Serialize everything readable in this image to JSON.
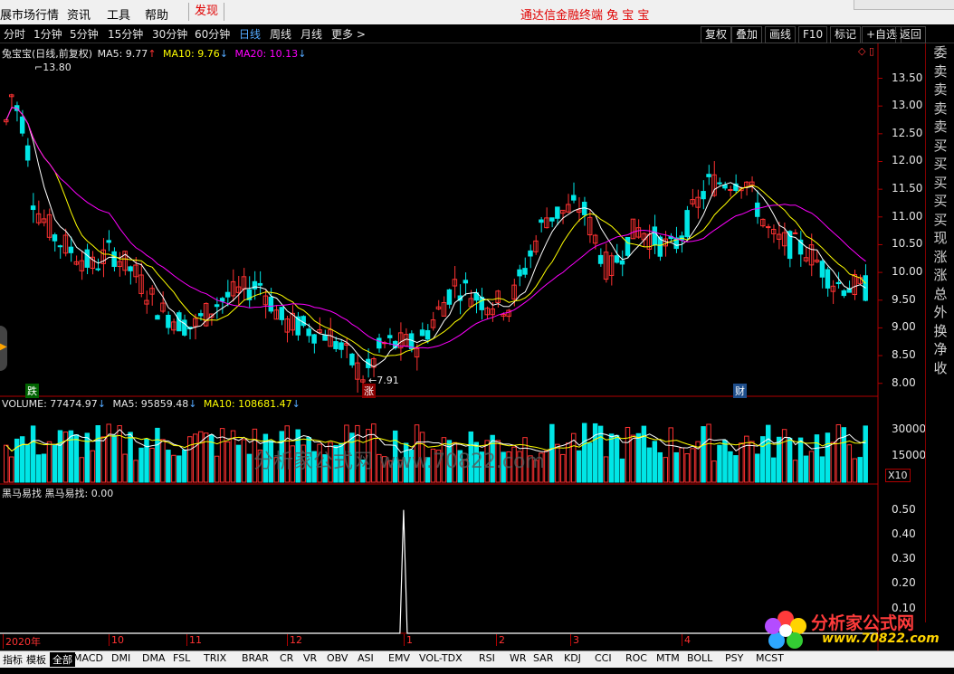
{
  "menu": {
    "items": [
      "展市场行情",
      "资讯",
      "工具",
      "帮助"
    ],
    "discover": "发现",
    "app_title": "通达信金融终端  兔 宝 宝"
  },
  "periods": {
    "items": [
      "分时",
      "1分钟",
      "5分钟",
      "15分钟",
      "30分钟",
      "60分钟",
      "日线",
      "周线",
      "月线",
      "更多 >"
    ],
    "active": "日线"
  },
  "toolbar_right": [
    "复权",
    "叠加",
    "画线",
    "F10",
    "标记",
    "+自选",
    "返回"
  ],
  "main_legend": {
    "name": "兔宝宝(日线,前复权)",
    "ma5": "MA5: 9.77",
    "ma10": "MA10: 9.76",
    "ma20": "MA20: 10.13"
  },
  "price_axis": [
    "13.50",
    "13.00",
    "12.50",
    "12.00",
    "11.50",
    "11.00",
    "10.50",
    "10.00",
    "9.50",
    "9.00",
    "8.50",
    "8.00"
  ],
  "price_marks": {
    "high": "13.80",
    "low": "7.91"
  },
  "badges": {
    "fall": "跌",
    "rise": "涨",
    "wealth": "财"
  },
  "volume_legend": {
    "volume": "VOLUME: 77474.97",
    "ma5": "MA5: 95859.48",
    "ma10": "MA10: 108681.47"
  },
  "volume_axis": [
    "30000",
    "15000"
  ],
  "volume_unit": "X10",
  "indicator_legend": "黑马易找  黑马易找: 0.00",
  "indicator_axis": [
    "0.50",
    "0.40",
    "0.30",
    "0.20",
    "0.10"
  ],
  "date_axis": [
    {
      "label": "2020年"
    },
    {
      "label": "10"
    },
    {
      "label": "11"
    },
    {
      "label": "12"
    },
    {
      "label": "1"
    },
    {
      "label": "2"
    },
    {
      "label": "3"
    },
    {
      "label": "4"
    }
  ],
  "side_panel": [
    "委",
    "卖",
    "卖",
    "卖",
    "卖",
    "买",
    "买",
    "买",
    "买",
    "买",
    "现",
    "涨",
    "涨",
    "总",
    "外",
    "换",
    "净",
    "收"
  ],
  "bottom_tabs": [
    "指标",
    "模板",
    "全部",
    "MACD",
    "DMI",
    "DMA",
    "FSL",
    "TRIX",
    "BRAR",
    "CR",
    "VR",
    "OBV",
    "ASI",
    "EMV",
    "VOL-TDX",
    "RSI",
    "WR",
    "SAR",
    "KDJ",
    "CCI",
    "ROC",
    "MTM",
    "BOLL",
    "PSY",
    "MCST"
  ],
  "bottom_selected": "全部",
  "watermark": "分析家公式网 www.70822.com",
  "logo": {
    "name": "分析家公式网",
    "url": "www.70822.com"
  },
  "colors": {
    "up": "#ff3232",
    "down": "#00e6e6",
    "ma5": "#ffffff",
    "ma10": "#ffff00",
    "ma20": "#ff00ff",
    "axis": "#b00000"
  },
  "chart_data": [
    {
      "type": "candlestick",
      "title": "兔宝宝(日线,前复权)",
      "ylim": [
        7.8,
        13.9
      ],
      "series": [
        {
          "name": "MA5",
          "last": 9.77
        },
        {
          "name": "MA10",
          "last": 9.76
        },
        {
          "name": "MA20",
          "last": 10.13
        }
      ]
    },
    {
      "type": "bar",
      "title": "VOLUME",
      "series": [
        {
          "name": "VOLUME",
          "last": 77474.97
        },
        {
          "name": "MA5",
          "last": 95859.48
        },
        {
          "name": "MA10",
          "last": 108681.47
        }
      ]
    },
    {
      "type": "line",
      "title": "黑马易找",
      "series": [
        {
          "name": "黑马易找",
          "last": 0.0
        }
      ],
      "ylim": [
        0,
        0.55
      ]
    }
  ]
}
